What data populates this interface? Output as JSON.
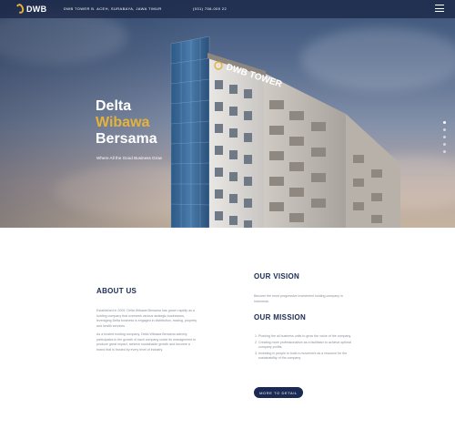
{
  "header": {
    "logo_text": "DWB",
    "address": "DWB TOWER B. ACEH, SURABAYA, JAWA TIMUR",
    "phone": "(031) 756-000 22",
    "menu_icon": "hamburger-icon"
  },
  "hero": {
    "title_line1": "Delta",
    "title_line2": "Wibawa",
    "title_line3": "Bersama",
    "tagline": "Where All the Good Business Grow",
    "building_sign": "DWB TOWER",
    "slides": 5,
    "active_slide": 1
  },
  "about": {
    "heading": "ABOUT US",
    "paragraph1": "Established in 2009, Delta Wibawa Bersama has grown rapidly as a holding company that oversees various strategic businesses, leveraging Delta business is engaged in distribution, trading, property and health services.",
    "paragraph2": "As a trusted holding company, Delta Wibawa Bersama actively participates in the growth of each company under its management to produce great impact, achieve sustainable growth and become a brand that is trusted by every level of industry."
  },
  "vision": {
    "heading": "OUR VISION",
    "text": "Become the most progressive investment holding company in Indonesia."
  },
  "mission": {
    "heading": "OUR MISSION",
    "items": [
      "Pushing the all business units to grow the value of the company.",
      "Creating more professionalism as a facilitator to achieve optimal company profits.",
      "Investing in people to build a movement as a resource for the sustainability of the company."
    ]
  },
  "cta": {
    "label": "MORE TO DETAIL"
  },
  "colors": {
    "navy": "#1b2a55",
    "gold": "#e5b23a",
    "body_text": "#8a8f99"
  }
}
